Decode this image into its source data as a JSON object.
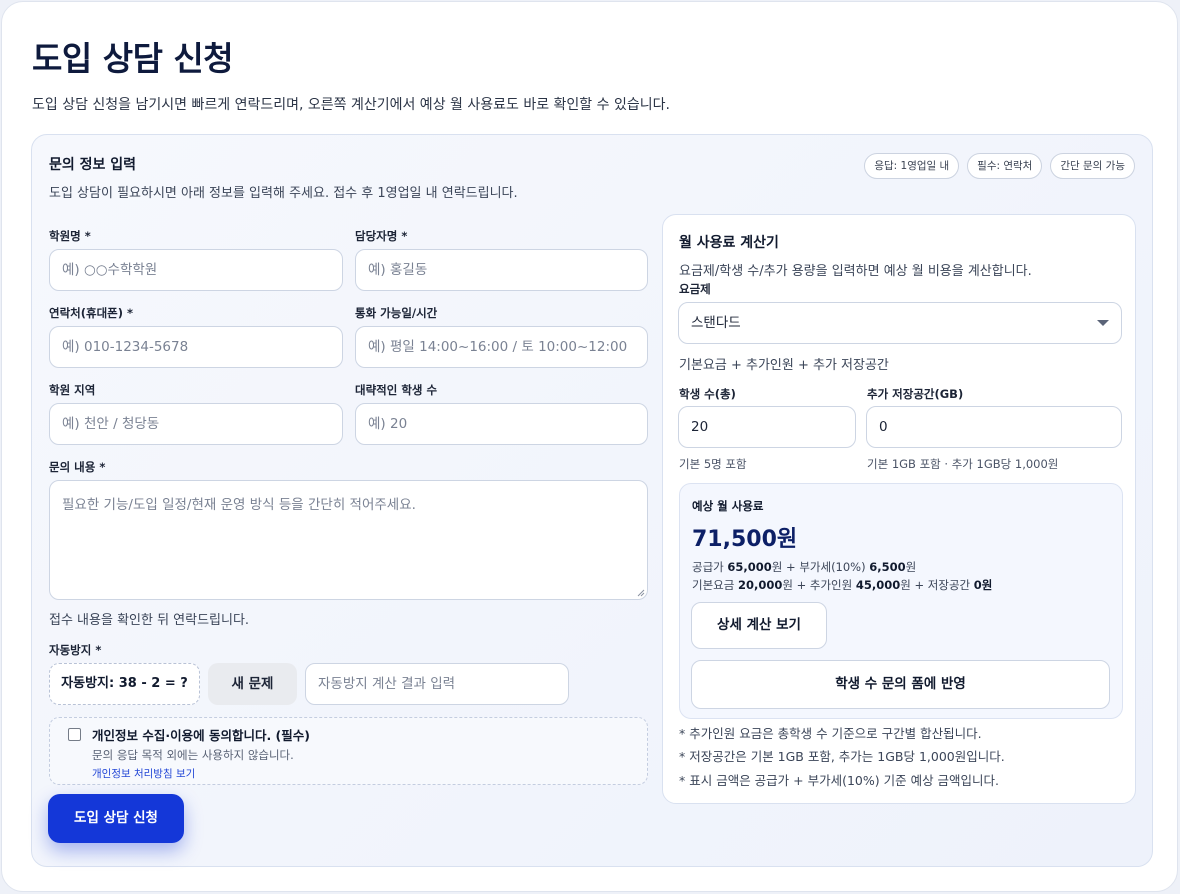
{
  "page": {
    "title": "도입 상담 신청",
    "description": "도입 상담 신청을 남기시면 빠르게 연락드리며, 오른쪽 계산기에서 예상 월 사용료도 바로 확인할 수 있습니다."
  },
  "form": {
    "title": "문의 정보 입력",
    "subtitle": "도입 상담이 필요하시면 아래 정보를 입력해 주세요. 접수 후 1영업일 내 연락드립니다.",
    "chips": [
      "응답: 1영업일 내",
      "필수: 연락처",
      "간단 문의 가능"
    ],
    "academy_name": {
      "label": "학원명 *",
      "placeholder": "예) ○○수학학원"
    },
    "manager_name": {
      "label": "담당자명 *",
      "placeholder": "예) 홍길동"
    },
    "phone": {
      "label": "연락처(휴대폰) *",
      "placeholder": "예) 010-1234-5678"
    },
    "call_time": {
      "label": "통화 가능일/시간",
      "placeholder": "예) 평일 14:00~16:00 / 토 10:00~12:00"
    },
    "region": {
      "label": "학원 지역",
      "placeholder": "예) 천안 / 청당동"
    },
    "student_count": {
      "label": "대략적인 학생 수",
      "placeholder": "예) 20"
    },
    "inquiry": {
      "label": "문의 내용 *",
      "placeholder": "필요한 기능/도입 일정/현재 운영 방식 등을 간단히 적어주세요."
    },
    "inquiry_note": "접수 내용을 확인한 뒤 연락드립니다.",
    "captcha": {
      "label": "자동방지 *",
      "question": "자동방지: 38 - 2 = ?",
      "new_button": "새 문제",
      "placeholder": "자동방지 계산 결과 입력"
    },
    "consent": {
      "title": "개인정보 수집·이용에 동의합니다. (필수)",
      "description": "문의 응답 목적 외에는 사용하지 않습니다.",
      "link": "개인정보 처리방침 보기",
      "checked": false
    },
    "submit_label": "도입 상담 신청"
  },
  "calculator": {
    "title": "월 사용료 계산기",
    "subtitle": "요금제/학생 수/추가 용량을 입력하면 예상 월 비용을 계산합니다.",
    "plan_label": "요금제",
    "plan_value": "스탠다드",
    "plan_desc": "기본요금 + 추가인원 + 추가 저장공간",
    "students": {
      "label": "학생 수(총)",
      "value": "20",
      "hint": "기본 5명 포함"
    },
    "storage": {
      "label": "추가 저장공간(GB)",
      "value": "0",
      "hint": "기본 1GB 포함 · 추가 1GB당 1,000원"
    },
    "estimate": {
      "label": "예상 월 사용료",
      "total": "71,500원",
      "supply_prefix": "공급가 ",
      "supply": "65,000",
      "vat_prefix": "원 + 부가세(10%) ",
      "vat": "6,500",
      "won": "원",
      "base_prefix": "기본요금 ",
      "base": "20,000",
      "extra_prefix": "원 + 추가인원 ",
      "extra": "45,000",
      "storage_prefix": "원 + 저장공간 ",
      "storage": "0원",
      "detail_button": "상세 계산 보기",
      "apply_button": "학생 수 문의 폼에 반영"
    },
    "notes": [
      "* 추가인원 요금은 총학생 수 기준으로 구간별 합산됩니다.",
      "* 저장공간은 기본 1GB 포함, 추가는 1GB당 1,000원입니다.",
      "* 표시 금액은 공급가 + 부가세(10%) 기준 예상 금액입니다."
    ]
  }
}
